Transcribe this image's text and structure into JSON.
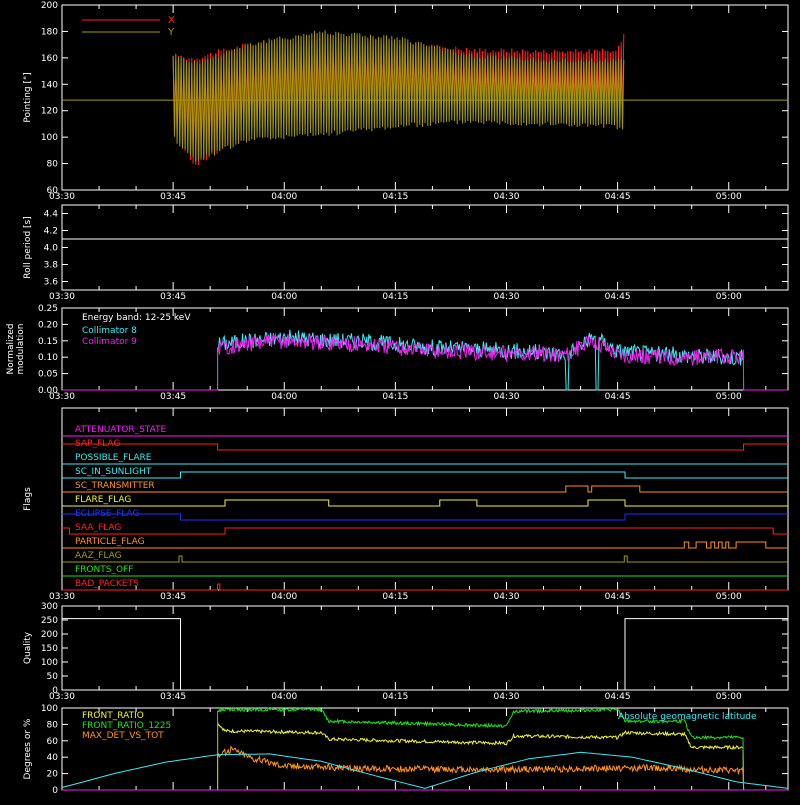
{
  "colors": {
    "background": "#000000",
    "axes": "#ffffff",
    "red": "#ff2020",
    "olive": "#a09a10",
    "cyan": "#40e8f0",
    "magenta": "#f020f0",
    "green": "#20e020",
    "yellow": "#f0f040",
    "orange": "#ff9020",
    "blue": "#2030ff",
    "purple": "#c040d0"
  },
  "time_axis": {
    "range": [
      "03:30",
      "05:08"
    ],
    "tick_labels": [
      "03:30",
      "03:45",
      "04:00",
      "04:15",
      "04:30",
      "04:45",
      "05:00"
    ]
  },
  "chart_data": [
    {
      "type": "line",
      "panel": "pointing",
      "ylabel": "Pointing [\"]",
      "ylim": [
        60,
        200
      ],
      "yticks": [
        "60",
        "80",
        "100",
        "120",
        "140",
        "160",
        "180",
        "200"
      ],
      "legend": [
        "X",
        "Y"
      ],
      "legend_placement": "top-left",
      "reference_line": 128,
      "series": [
        {
          "name": "X",
          "color": "red",
          "x": [
            "03:45",
            "03:48",
            "03:55",
            "04:05",
            "04:15",
            "04:25",
            "04:35",
            "04:45",
            "04:46"
          ],
          "y_max": [
            160,
            160,
            170,
            175,
            172,
            166,
            165,
            165,
            183
          ],
          "y_min": [
            105,
            78,
            105,
            112,
            118,
            120,
            122,
            122,
            106
          ]
        },
        {
          "name": "Y",
          "color": "olive",
          "x": [
            "03:45",
            "03:48",
            "03:55",
            "04:05",
            "04:15",
            "04:25",
            "04:35",
            "04:45",
            "04:46"
          ],
          "y_max": [
            163,
            156,
            170,
            180,
            175,
            162,
            158,
            158,
            158
          ],
          "y_min": [
            100,
            82,
            98,
            102,
            108,
            112,
            110,
            108,
            104
          ]
        }
      ]
    },
    {
      "type": "line",
      "panel": "roll-period",
      "ylabel": "Roll period [s]",
      "ylim": [
        3.5,
        4.5
      ],
      "yticks": [
        "3.6",
        "3.8",
        "4.0",
        "4.2",
        "4.4"
      ],
      "series": [
        {
          "name": "",
          "color": "axes",
          "x": [
            "03:30",
            "05:08"
          ],
          "y": [
            4.1,
            4.1
          ]
        }
      ]
    },
    {
      "type": "line",
      "panel": "modulation",
      "ylabel": "Normalized modulation",
      "ylim": [
        0,
        0.25
      ],
      "yticks": [
        "0.00",
        "0.05",
        "0.10",
        "0.15",
        "0.20",
        "0.25"
      ],
      "annotation": "Energy band: 12-25 keV",
      "legend": [
        "Collimator 8",
        "Collimator 9"
      ],
      "legend_placement": "top-left",
      "series": [
        {
          "name": "Collimator 8",
          "color": "cyan",
          "x": [
            "03:51",
            "03:55",
            "04:00",
            "04:10",
            "04:20",
            "04:30",
            "04:38",
            "04:42",
            "04:45",
            "04:50",
            "05:00",
            "05:02"
          ],
          "y": [
            0.14,
            0.15,
            0.16,
            0.15,
            0.13,
            0.12,
            0.11,
            0.16,
            0.12,
            0.11,
            0.1,
            0.1
          ]
        },
        {
          "name": "Collimator 9",
          "color": "magenta",
          "x": [
            "03:51",
            "03:55",
            "04:00",
            "04:10",
            "04:20",
            "04:30",
            "04:38",
            "04:42",
            "04:45",
            "04:50",
            "05:00",
            "05:02"
          ],
          "y": [
            0.13,
            0.14,
            0.15,
            0.14,
            0.12,
            0.11,
            0.11,
            0.15,
            0.11,
            0.1,
            0.1,
            0.1
          ]
        }
      ]
    },
    {
      "type": "line",
      "panel": "flags",
      "ylabel": "Flags",
      "series": [
        {
          "name": "ATTENUATOR_STATE",
          "color": "magenta",
          "steps": [
            [
              "03:30",
              0
            ]
          ]
        },
        {
          "name": "SAP_FLAG",
          "color": "red",
          "steps": [
            [
              "03:30",
              1
            ],
            [
              "03:51",
              0
            ],
            [
              "05:02",
              1
            ]
          ]
        },
        {
          "name": "POSSIBLE_FLARE",
          "color": "cyan",
          "steps": [
            [
              "03:30",
              0
            ]
          ]
        },
        {
          "name": "SC_IN_SUNLIGHT",
          "color": "cyan",
          "steps": [
            [
              "03:30",
              0
            ],
            [
              "03:46",
              1
            ],
            [
              "04:46",
              0
            ]
          ]
        },
        {
          "name": "SC_TRANSMITTER",
          "color": "orange",
          "steps": [
            [
              "03:30",
              0
            ],
            [
              "04:38",
              1
            ],
            [
              "04:41",
              0
            ],
            [
              "04:41.5",
              1
            ],
            [
              "04:48",
              0
            ]
          ]
        },
        {
          "name": "FLARE_FLAG",
          "color": "yellow",
          "steps": [
            [
              "03:30",
              0
            ],
            [
              "03:52",
              1
            ],
            [
              "04:06",
              0
            ],
            [
              "04:21",
              1
            ],
            [
              "04:26",
              0
            ],
            [
              "04:41",
              1
            ],
            [
              "04:46",
              0
            ]
          ]
        },
        {
          "name": "ECLIPSE_FLAG",
          "color": "blue",
          "steps": [
            [
              "03:30",
              1
            ],
            [
              "03:46",
              0
            ],
            [
              "04:46",
              1
            ]
          ]
        },
        {
          "name": "SAA_FLAG",
          "color": "red",
          "steps": [
            [
              "03:30",
              1
            ],
            [
              "03:31",
              0
            ],
            [
              "03:52",
              1
            ],
            [
              "05:06",
              0
            ]
          ]
        },
        {
          "name": "PARTICLE_FLAG",
          "color": "orange",
          "steps": [
            [
              "03:30",
              0
            ],
            [
              "04:54",
              1
            ],
            [
              "04:54.6",
              0
            ],
            [
              "04:55.6",
              1
            ],
            [
              "04:57",
              0
            ],
            [
              "04:57.6",
              1
            ],
            [
              "04:58.1",
              0
            ],
            [
              "04:58.6",
              1
            ],
            [
              "04:59.1",
              0
            ],
            [
              "04:59.6",
              1
            ],
            [
              "05:00",
              0
            ],
            [
              "05:01",
              1
            ],
            [
              "05:05",
              0
            ]
          ]
        },
        {
          "name": "AAZ_FLAG",
          "color": "olive",
          "steps": [
            [
              "03:30",
              0
            ],
            [
              "03:45.8",
              1
            ],
            [
              "03:46.2",
              0
            ],
            [
              "04:45.9",
              1
            ],
            [
              "04:46.3",
              0
            ]
          ]
        },
        {
          "name": "FRONTS_OFF",
          "color": "green",
          "steps": [
            [
              "03:30",
              0
            ]
          ]
        },
        {
          "name": "BAD_PACKETS",
          "color": "red",
          "steps": [
            [
              "03:30",
              0
            ],
            [
              "03:51",
              1
            ],
            [
              "03:51.3",
              0
            ]
          ]
        }
      ]
    },
    {
      "type": "line",
      "panel": "quality",
      "ylabel": "Quality",
      "ylim": [
        0,
        300
      ],
      "yticks": [
        "0",
        "50",
        "100",
        "150",
        "200",
        "250",
        "300"
      ],
      "series": [
        {
          "name": "",
          "color": "axes",
          "steps": [
            [
              "03:30",
              255
            ],
            [
              "03:46",
              0
            ],
            [
              "04:46",
              255
            ],
            [
              "05:08",
              255
            ]
          ]
        }
      ]
    },
    {
      "type": "line",
      "panel": "ratios",
      "ylabel": "Degrees or %",
      "ylim": [
        0,
        100
      ],
      "yticks": [
        "0",
        "20",
        "40",
        "60",
        "80",
        "100"
      ],
      "legend": [
        "FRONT_RATIO",
        "FRONT_RATIO_1225",
        "MAX_DET_VS_TOT"
      ],
      "legend_placement": "top-left",
      "annotation": "Absolute geomagnetic latitude",
      "series": [
        {
          "name": "FRONT_RATIO",
          "color": "yellow",
          "x": [
            "03:51",
            "03:52",
            "04:05",
            "04:06",
            "04:30",
            "04:31",
            "04:45",
            "04:46",
            "04:54",
            "04:55",
            "05:02"
          ],
          "y": [
            82,
            72,
            70,
            62,
            57,
            66,
            64,
            70,
            68,
            52,
            52
          ]
        },
        {
          "name": "FRONT_RATIO_1225",
          "color": "green",
          "x": [
            "03:51",
            "03:52",
            "04:05",
            "04:06",
            "04:30",
            "04:31",
            "04:45",
            "04:46",
            "04:54",
            "04:55",
            "05:02"
          ],
          "y": [
            96,
            98,
            98,
            84,
            78,
            96,
            98,
            84,
            84,
            64,
            64
          ]
        },
        {
          "name": "MAX_DET_VS_TOT",
          "color": "orange",
          "x": [
            "03:51",
            "03:53",
            "03:56",
            "04:00",
            "04:10",
            "04:30",
            "04:50",
            "05:02"
          ],
          "y": [
            42,
            50,
            38,
            30,
            26,
            25,
            27,
            23
          ]
        },
        {
          "name": "Absolute geomagnetic latitude",
          "color": "cyan",
          "x": [
            "03:30",
            "03:37",
            "03:44",
            "03:51",
            "03:58",
            "04:05",
            "04:12",
            "04:19",
            "04:26",
            "04:33",
            "04:40",
            "04:47",
            "04:54",
            "05:01",
            "05:08"
          ],
          "y": [
            3,
            20,
            34,
            43,
            44,
            35,
            18,
            2,
            22,
            38,
            46,
            40,
            26,
            10,
            2
          ]
        }
      ]
    }
  ]
}
